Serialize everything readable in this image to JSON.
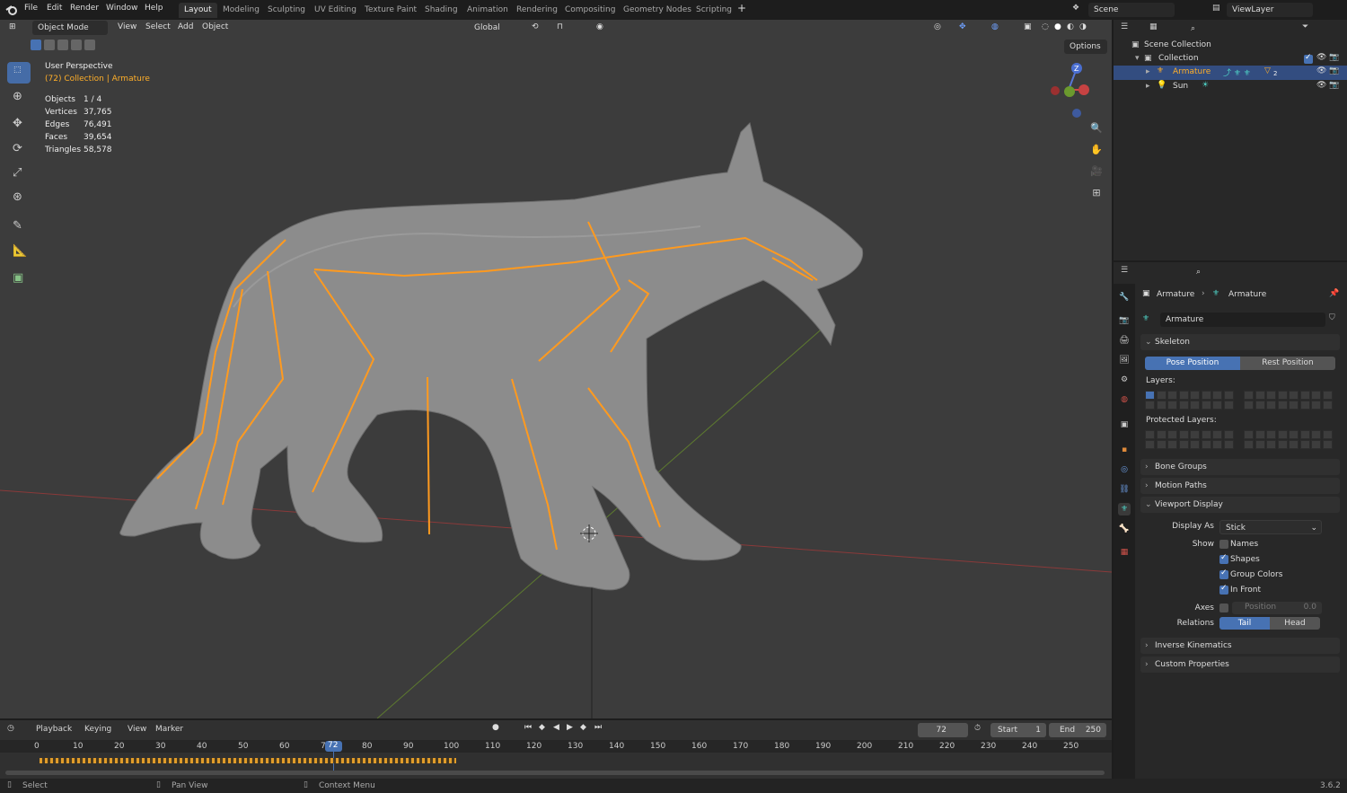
{
  "topbar": {
    "menus": [
      "File",
      "Edit",
      "Render",
      "Window",
      "Help"
    ],
    "workspaces": [
      "Layout",
      "Modeling",
      "Sculpting",
      "UV Editing",
      "Texture Paint",
      "Shading",
      "Animation",
      "Rendering",
      "Compositing",
      "Geometry Nodes",
      "Scripting"
    ],
    "add_tab": "+",
    "scene": "Scene",
    "view_layer": "ViewLayer"
  },
  "viewport": {
    "mode": "Object Mode",
    "menus": [
      "View",
      "Select",
      "Add",
      "Object"
    ],
    "transform_orientation": "Global",
    "options": "Options",
    "perspective": "User Perspective",
    "context": "(72) Collection | Armature",
    "stats": [
      {
        "label": "Objects",
        "value": "1 / 4"
      },
      {
        "label": "Vertices",
        "value": "37,765"
      },
      {
        "label": "Edges",
        "value": "76,491"
      },
      {
        "label": "Faces",
        "value": "39,654"
      },
      {
        "label": "Triangles",
        "value": "58,578"
      }
    ],
    "gizmo_axis": "Z"
  },
  "outliner": {
    "root": "Scene Collection",
    "collection": "Collection",
    "items": [
      {
        "name": "Armature",
        "badge": "2"
      },
      {
        "name": "Sun"
      }
    ]
  },
  "properties": {
    "breadcrumb": [
      "Armature",
      "Armature"
    ],
    "data_name": "Armature",
    "skeleton": "Skeleton",
    "pose_position": "Pose Position",
    "rest_position": "Rest Position",
    "layers": "Layers:",
    "protected_layers": "Protected Layers:",
    "bone_groups": "Bone Groups",
    "motion_paths": "Motion Paths",
    "viewport_display": "Viewport Display",
    "display_as_label": "Display As",
    "display_as_value": "Stick",
    "show_label": "Show",
    "show_items": [
      {
        "label": "Names",
        "checked": false
      },
      {
        "label": "Shapes",
        "checked": true
      },
      {
        "label": "Group Colors",
        "checked": true
      },
      {
        "label": "In Front",
        "checked": true
      }
    ],
    "axes_label": "Axes",
    "axes_position": "Position",
    "axes_value": "0.0",
    "relations_label": "Relations",
    "relations_tail": "Tail",
    "relations_head": "Head",
    "inverse_kinematics": "Inverse Kinematics",
    "custom_properties": "Custom Properties"
  },
  "timeline": {
    "menus": [
      "Playback",
      "Keying",
      "View",
      "Marker"
    ],
    "current_frame": "72",
    "start_label": "Start",
    "start": "1",
    "end_label": "End",
    "end": "250",
    "ticks": [
      "0",
      "10",
      "20",
      "30",
      "40",
      "50",
      "60",
      "7",
      "72",
      "80",
      "90",
      "100",
      "110",
      "120",
      "130",
      "140",
      "150",
      "160",
      "170",
      "180",
      "190",
      "200",
      "210",
      "220",
      "230",
      "240",
      "250"
    ]
  },
  "statusbar": {
    "select": "Select",
    "pan": "Pan View",
    "context": "Context Menu",
    "version": "3.6.2"
  },
  "colors": {
    "accent": "#4772b3",
    "bone": "#ff9a1f",
    "active_text": "#ffaf29",
    "viewport_bg": "#3c3c3c"
  }
}
